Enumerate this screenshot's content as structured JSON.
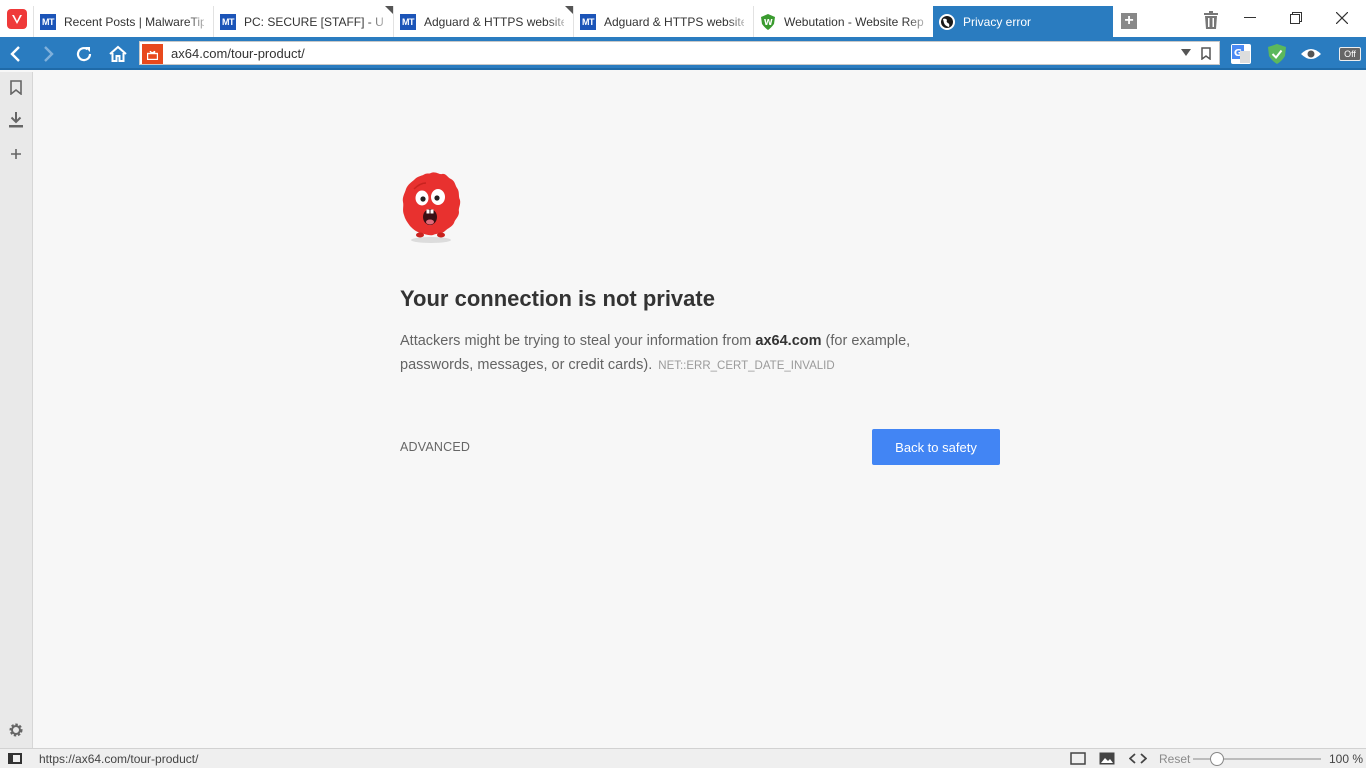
{
  "tabs": [
    {
      "favicon": "MT",
      "title": "Recent Posts | MalwareTips",
      "stacked": false
    },
    {
      "favicon": "MT",
      "title": "PC: SECURE [STAFF] - Umbra",
      "stacked": true
    },
    {
      "favicon": "MT",
      "title": "Adguard & HTTPS websites",
      "stacked": true
    },
    {
      "favicon": "MT",
      "title": "Adguard & HTTPS websites",
      "stacked": false
    },
    {
      "favicon": "webutation-icon",
      "title": "Webutation - Website Reputation",
      "stacked": false
    },
    {
      "favicon": "globe-icon",
      "title": "Privacy error",
      "stacked": false,
      "active": true
    }
  ],
  "window": {
    "minimize": "—",
    "restore": "❐",
    "close": "✕"
  },
  "address": {
    "url": "ax64.com/tour-product/"
  },
  "extensions": {
    "off_label": "Off"
  },
  "page": {
    "heading": "Your connection is not private",
    "message_prefix": "Attackers might be trying to steal your information from ",
    "domain": "ax64.com",
    "message_suffix": " (for example, passwords, messages, or credit cards).",
    "error_code": "NET::ERR_CERT_DATE_INVALID",
    "advanced": "ADVANCED",
    "back_button": "Back to safety"
  },
  "status": {
    "hover_url": "https://ax64.com/tour-product/",
    "reset": "Reset",
    "zoom": "100 %",
    "zoom_level": 100
  },
  "colors": {
    "accent": "#2a7cc0",
    "button": "#4285f4",
    "warning": "#e8491d",
    "monster": "#e8312f"
  }
}
